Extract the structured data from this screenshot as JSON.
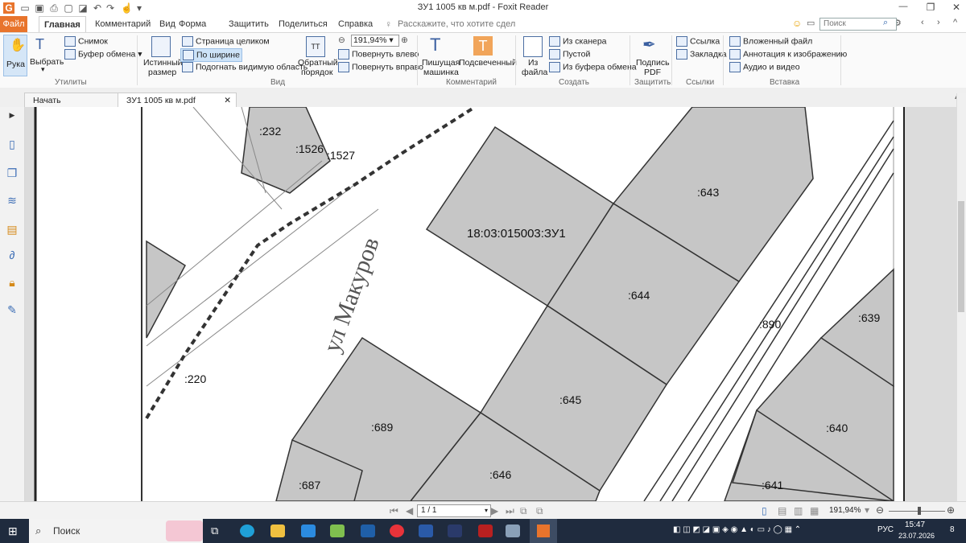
{
  "window": {
    "title": "ЗУ1 1005 кв м.pdf - Foxit Reader",
    "minimize": "—",
    "restore": "❐",
    "close": "✕"
  },
  "quick_access": {
    "app_icon": "G",
    "undo": "↶",
    "redo": "↷",
    "dropdown": "▾"
  },
  "ribbon_tabs": [
    "Файл",
    "Главная",
    "Комментарий",
    "Вид",
    "Форма",
    "Защитить",
    "Поделиться",
    "Справка"
  ],
  "tell_me": "Расскажите, что хотите сдел",
  "search": {
    "placeholder": "Поиск"
  },
  "ribbon": {
    "hand": "Рука",
    "select": "Выбрать",
    "snapshot": "Снимок",
    "clipboard": "Буфер обмена",
    "group_tools": "Утилиты",
    "actual_size_1": "Истинный",
    "actual_size_2": "размер",
    "fit_page": "Страница целиком",
    "fit_width": "По ширине",
    "fit_visible": "Подогнать видимую область",
    "zoom_value": "191,94%",
    "rotate_left": "Повернуть влево",
    "rotate_right": "Повернуть вправо",
    "reverse_1": "Обратный",
    "reverse_2": "порядок",
    "group_view": "Вид",
    "typewriter_1": "Пишущая",
    "typewriter_2": "машинка",
    "highlight": "Подсвеченный",
    "group_comment": "Комментарий",
    "from_file_1": "Из",
    "from_file_2": "файла",
    "from_scanner": "Из сканера",
    "blank": "Пустой",
    "from_clipboard": "Из буфера обмена",
    "group_create": "Создать",
    "sign_1": "Подпись",
    "sign_2": "PDF",
    "group_protect": "Защитить",
    "link": "Ссылка",
    "bookmark": "Закладка",
    "group_links": "Ссылки",
    "attached_file": "Вложенный файл",
    "image_annot": "Аннотация к изображению",
    "audio_video": "Аудио и видео",
    "group_insert": "Вставка"
  },
  "doc_tabs": {
    "start": "Начать",
    "file": "ЗУ1 1005 кв м.pdf",
    "close": "✕"
  },
  "map_labels": {
    "l232": ":232",
    "l1526": ":1526",
    "l1527": ":1527",
    "l643": ":643",
    "main": "18:03:015003:ЗУ1",
    "l644": ":644",
    "l890": ":890",
    "l639": ":639",
    "l220": ":220",
    "l645": ":645",
    "l689": ":689",
    "l640": ":640",
    "l646": ":646",
    "l687": ":687",
    "l641": ":641",
    "street": "ул Макуров"
  },
  "status": {
    "page": "1 / 1",
    "zoom": "191,94%"
  },
  "taskbar": {
    "search_label": "Поиск",
    "lang": "РУС",
    "time": "15:47",
    "date": "23.07.2026",
    "notif": "8"
  },
  "colors": {
    "accent": "#e8742c",
    "map_fill": "#c9c9c9",
    "map_line": "#333333"
  }
}
